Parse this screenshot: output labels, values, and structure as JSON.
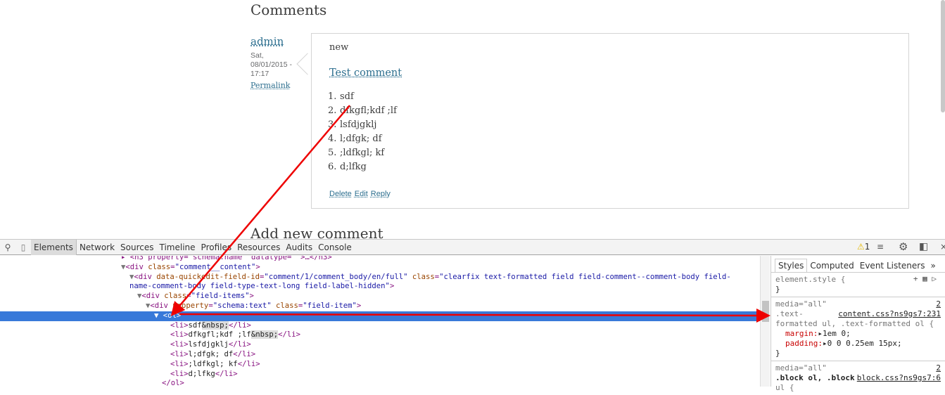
{
  "page": {
    "comments_heading": "Comments",
    "author": "admin",
    "date": "Sat, 08/01/2015 - 17:17",
    "permalink": "Permalink",
    "comment_subject": "new",
    "comment_title": "Test comment",
    "list": [
      "sdf",
      "dfkgfl;kdf ;lf",
      "lsfdjgklj",
      "l;dfgk; df",
      ";ldfkgl; kf",
      "d;lfkg"
    ],
    "list_numbers": [
      "1.",
      "2.",
      "3.",
      "4.",
      "5.",
      "6."
    ],
    "links": [
      "Delete",
      "Edit",
      "Reply"
    ],
    "add_heading": "Add new comment"
  },
  "devtools": {
    "tabs": [
      "Elements",
      "Network",
      "Sources",
      "Timeline",
      "Profiles",
      "Resources",
      "Audits",
      "Console"
    ],
    "warning_count": "1",
    "side_tabs": [
      "Styles",
      "Computed",
      "Event Listeners"
    ],
    "element_style": "element.style {",
    "close_brace": "}",
    "rule1": {
      "media": "media=\"all\"",
      "count": "2",
      "sel1": ".text-",
      "source": "content.css?ns9gs7:231",
      "sel2": "formatted ul, .text-formatted ol {",
      "p1": "margin:",
      "v1": "1em 0;",
      "p2": "padding:",
      "v2": "0 0 0.25em 15px;"
    },
    "rule2": {
      "media": "media=\"all\"",
      "count": "2",
      "sel1": ".block ol, .block",
      "source": "block.css?ns9gs7:6",
      "sel2": "ul {"
    }
  }
}
